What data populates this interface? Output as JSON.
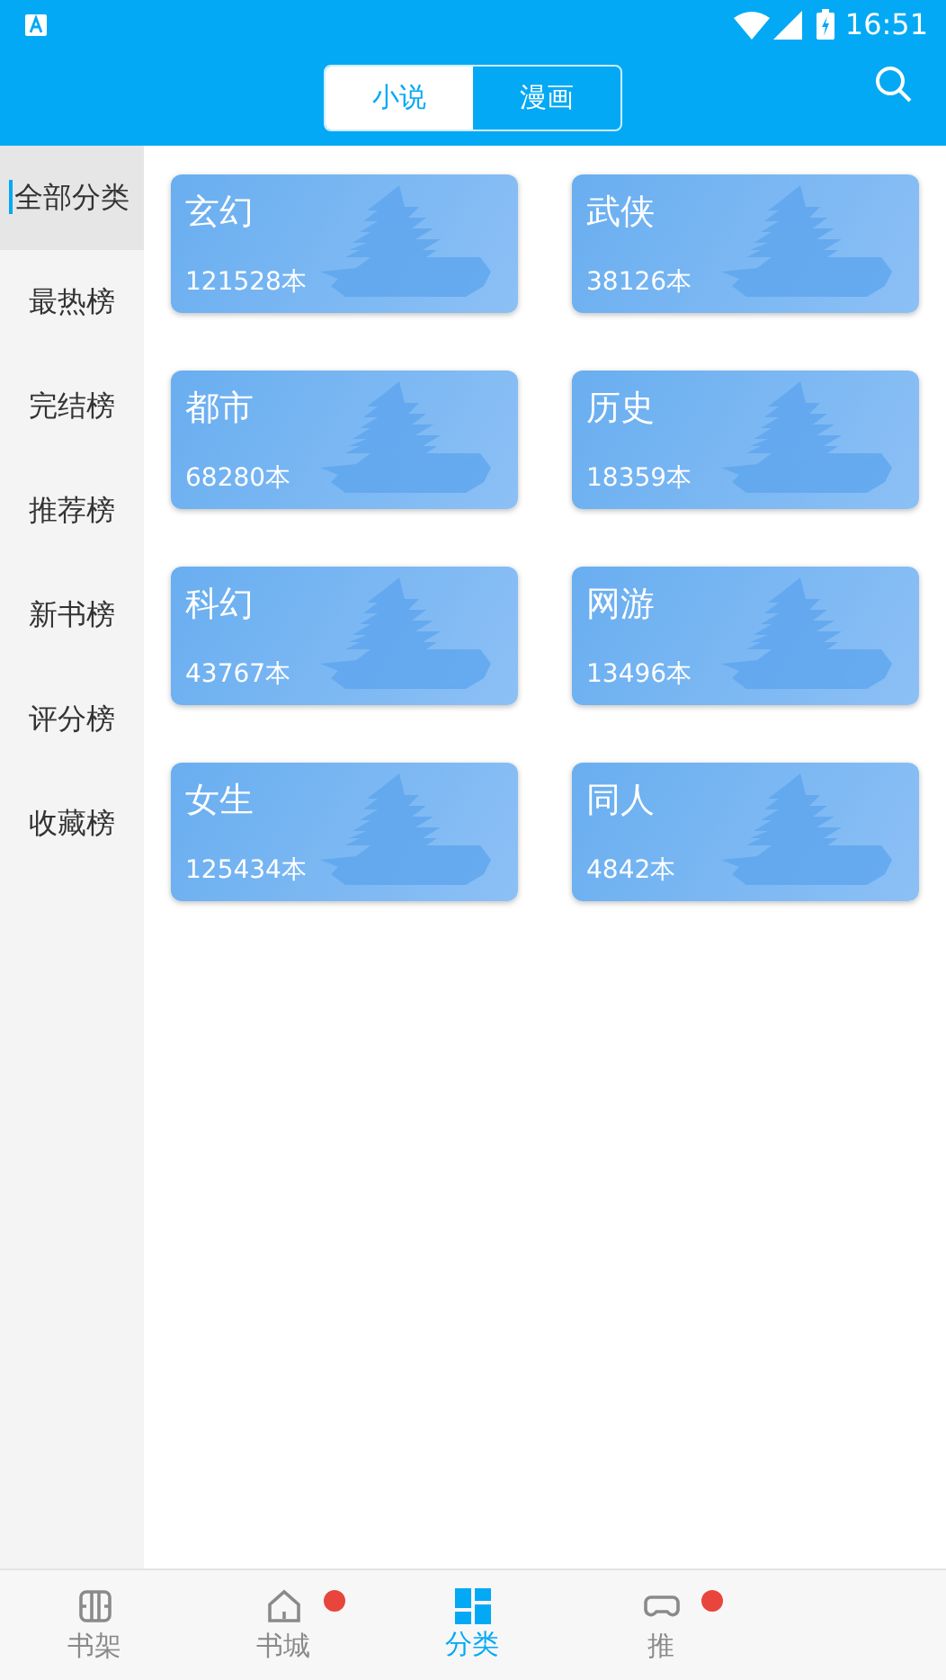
{
  "status_bar": {
    "time": "16:51"
  },
  "segments": [
    {
      "label": "小说",
      "selected": true
    },
    {
      "label": "漫画",
      "selected": false
    }
  ],
  "sidebar": {
    "items": [
      {
        "label": "全部分类",
        "selected": true
      },
      {
        "label": "最热榜",
        "selected": false
      },
      {
        "label": "完结榜",
        "selected": false
      },
      {
        "label": "推荐榜",
        "selected": false
      },
      {
        "label": "新书榜",
        "selected": false
      },
      {
        "label": "评分榜",
        "selected": false
      },
      {
        "label": "收藏榜",
        "selected": false
      }
    ]
  },
  "categories": [
    {
      "name": "玄幻",
      "count": "121528本"
    },
    {
      "name": "武侠",
      "count": "38126本"
    },
    {
      "name": "都市",
      "count": "68280本"
    },
    {
      "name": "历史",
      "count": "18359本"
    },
    {
      "name": "科幻",
      "count": "43767本"
    },
    {
      "name": "网游",
      "count": "13496本"
    },
    {
      "name": "女生",
      "count": "125434本"
    },
    {
      "name": "同人",
      "count": "4842本"
    }
  ],
  "bottom_nav": [
    {
      "kind": "shelf",
      "label": "书架",
      "selected": false,
      "badge": false
    },
    {
      "kind": "store",
      "label": "书城",
      "selected": false,
      "badge": true
    },
    {
      "kind": "category",
      "label": "分类",
      "selected": true,
      "badge": false
    },
    {
      "kind": "game",
      "label": "推",
      "selected": false,
      "badge": true
    }
  ]
}
